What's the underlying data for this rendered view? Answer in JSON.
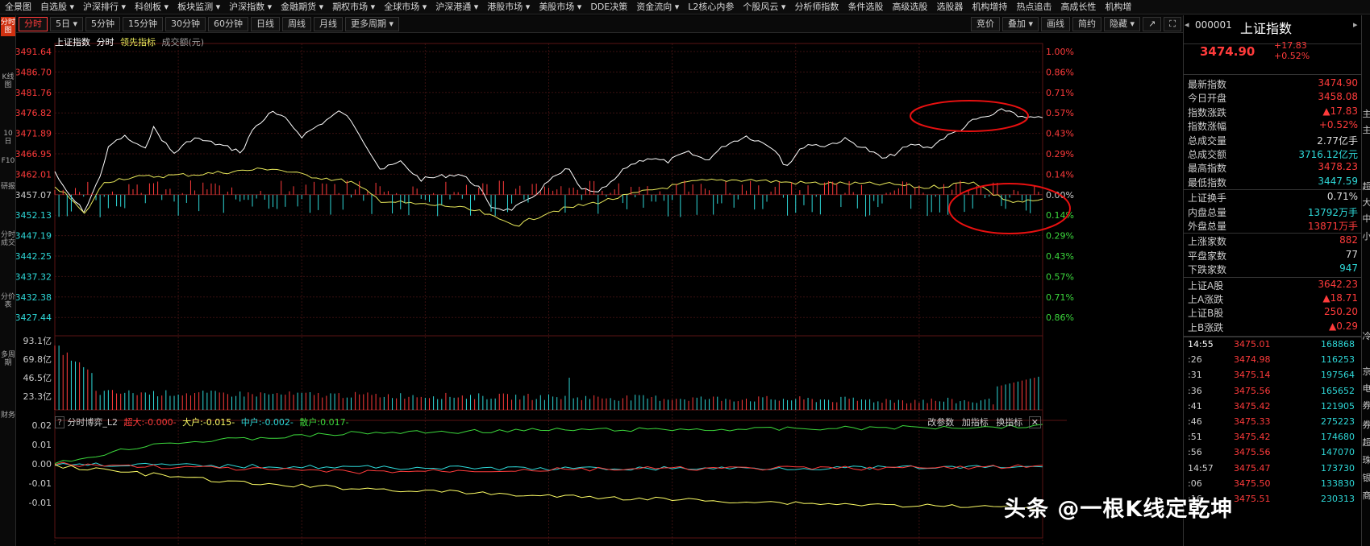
{
  "menu": [
    "全景图",
    "自选股 ▾",
    "沪深排行 ▾",
    "科创板 ▾",
    "板块监测 ▾",
    "沪深指数 ▾",
    "金融期货 ▾",
    "期权市场 ▾",
    "全球市场 ▾",
    "沪深港通 ▾",
    "港股市场 ▾",
    "美股市场 ▾",
    "DDE决策",
    "资金流向 ▾",
    "L2核心内参",
    "个股风云 ▾",
    "分析师指数",
    "条件选股",
    "高级选股",
    "选股器",
    "机构增持",
    "热点追击",
    "高成长性",
    "机构增"
  ],
  "left_strip": [
    "分时图",
    "K线图",
    "10日",
    "F10",
    "研报",
    "分时成交",
    "分价表",
    "多周期",
    "财务"
  ],
  "tabs": [
    "分时",
    "5日 ▾",
    "5分钟",
    "15分钟",
    "30分钟",
    "60分钟",
    "日线",
    "周线",
    "月线",
    "更多周期 ▾"
  ],
  "tabs_right": [
    "竞价",
    "叠加 ▾",
    "画线",
    "简约",
    "隐藏 ▾"
  ],
  "tabs_right_icons": [
    "↗",
    "⛶"
  ],
  "legend": {
    "index": "上证指数",
    "mode": "分时",
    "lead": "领先指标",
    "turnover": "成交额(元)"
  },
  "price_axis": [
    "3491.64",
    "3486.70",
    "3481.76",
    "3476.82",
    "3471.89",
    "3466.95",
    "3462.01",
    "3457.07",
    "3452.13",
    "3447.19",
    "3442.25",
    "3437.32",
    "3432.38",
    "3427.44"
  ],
  "pct_axis": [
    "1.00%",
    "0.86%",
    "0.71%",
    "0.57%",
    "0.43%",
    "0.29%",
    "0.14%",
    "0.00%",
    "0.14%",
    "0.29%",
    "0.43%",
    "0.57%",
    "0.71%",
    "0.86%"
  ],
  "volume_axis": [
    "93.1亿",
    "69.8亿",
    "46.5亿",
    "23.3亿"
  ],
  "flow": {
    "label": "分时博弈_L2",
    "super": "超大:-0.000-",
    "big": "大户:-0.015-",
    "mid": "中户:-0.002-",
    "retail": "散户:0.017-",
    "btn1": "改参数",
    "btn2": "加指标",
    "btn3": "换指标",
    "axis": [
      "0.02",
      "0.01",
      "0.00",
      "-0.01",
      "-0.01"
    ]
  },
  "colors": {
    "up": "#ff3b3b",
    "down": "#2ed8d8",
    "price": "#ffffff",
    "avg": "#e8e85a",
    "grid": "#3a1010",
    "super": "#ff3b3b",
    "big": "#ffff66",
    "mid": "#2ed8d8",
    "retail": "#3cd83c"
  },
  "quote": {
    "code": "000001",
    "name": "上证指数",
    "price": "3474.90",
    "change": "+17.83",
    "pct": "+0.52%"
  },
  "stats": [
    {
      "k": "最新指数",
      "v": "3474.90",
      "c": "up"
    },
    {
      "k": "今日开盘",
      "v": "3458.08",
      "c": "up"
    },
    {
      "k": "指数涨跌",
      "v": "▲17.83",
      "c": "up"
    },
    {
      "k": "指数涨幅",
      "v": "+0.52%",
      "c": "up"
    },
    {
      "k": "总成交量",
      "v": "2.77亿手",
      "c": "white"
    },
    {
      "k": "总成交额",
      "v": "3716.12亿元",
      "c": "cyan"
    },
    {
      "k": "最高指数",
      "v": "3478.23",
      "c": "up"
    },
    {
      "k": "最低指数",
      "v": "3447.59",
      "c": "down"
    },
    {
      "k": "上证换手",
      "v": "0.71%",
      "c": "white"
    },
    {
      "k": "内盘总量",
      "v": "13792万手",
      "c": "down"
    },
    {
      "k": "外盘总量",
      "v": "13871万手",
      "c": "up"
    },
    {
      "k": "上涨家数",
      "v": "882",
      "c": "up"
    },
    {
      "k": "平盘家数",
      "v": "77",
      "c": "white"
    },
    {
      "k": "下跌家数",
      "v": "947",
      "c": "down"
    },
    {
      "k": "上证A股",
      "v": "3642.23",
      "c": "up"
    },
    {
      "k": "上A涨跌",
      "v": "▲18.71",
      "c": "up"
    },
    {
      "k": "上证B股",
      "v": "250.20",
      "c": "up"
    },
    {
      "k": "上B涨跌",
      "v": "▲0.29",
      "c": "up"
    }
  ],
  "ticks": [
    {
      "t": "14:55",
      "p": "3475.01",
      "v": "168868"
    },
    {
      "t": ":26",
      "p": "3474.98",
      "v": "116253"
    },
    {
      "t": ":31",
      "p": "3475.14",
      "v": "197564"
    },
    {
      "t": ":36",
      "p": "3475.56",
      "v": "165652"
    },
    {
      "t": ":41",
      "p": "3475.42",
      "v": "121905"
    },
    {
      "t": ":46",
      "p": "3475.33",
      "v": "275223"
    },
    {
      "t": ":51",
      "p": "3475.42",
      "v": "174680"
    },
    {
      "t": ":56",
      "p": "3475.56",
      "v": "147070"
    },
    {
      "t": "14:57",
      "p": "3475.47",
      "v": "173730"
    },
    {
      "t": ":06",
      "p": "3475.50",
      "v": "133830"
    },
    {
      "t": ":16",
      "p": "3475.51",
      "v": "230313"
    }
  ],
  "edge_labels": [
    "主",
    "主",
    "超",
    "大",
    "中",
    "小",
    "冷",
    "京",
    "电",
    "券",
    "券",
    "超",
    "珠",
    "银",
    "商"
  ],
  "watermark": "头条 @一根K线定乾坤"
}
